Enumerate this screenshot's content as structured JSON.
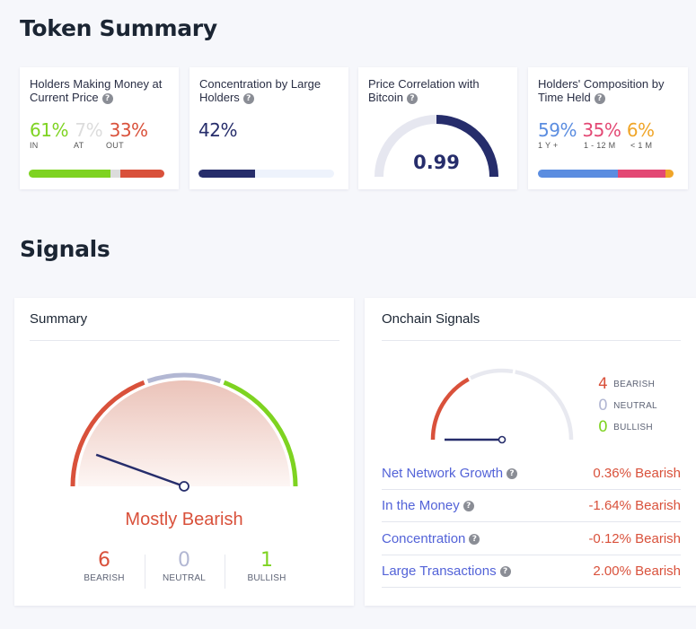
{
  "colors": {
    "green": "#7ed321",
    "red": "#d9513b",
    "grey_light": "#dcdcdc",
    "navy": "#262d6b",
    "neutral": "#b2b7d3",
    "blue": "#5b8de0",
    "pink": "#e34874",
    "orange": "#f0a528",
    "link": "#5363d8"
  },
  "token_summary": {
    "heading": "Token Summary",
    "cards": {
      "money": {
        "title": "Holders Making Money at Current Price",
        "help_icon": "?",
        "items": [
          {
            "value": "61%",
            "label": "IN",
            "fraction": 0.61
          },
          {
            "value": "7%",
            "label": "AT",
            "fraction": 0.07
          },
          {
            "value": "33%",
            "label": "OUT",
            "fraction": 0.33
          }
        ]
      },
      "concentration": {
        "title": "Concentration by Large Holders",
        "help_icon": "?",
        "value": "42%",
        "fraction": 0.42
      },
      "correlation": {
        "title": "Price Correlation with Bitcoin",
        "help_icon": "?",
        "value": "0.99",
        "numeric": 0.99,
        "range": [
          -1,
          1
        ]
      },
      "composition": {
        "title": "Holders' Composition by Time Held",
        "help_icon": "?",
        "items": [
          {
            "value": "59%",
            "label": "1 Y +",
            "fraction": 0.59
          },
          {
            "value": "35%",
            "label": "1 - 12 M",
            "fraction": 0.35
          },
          {
            "value": "6%",
            "label": "< 1 M",
            "fraction": 0.06
          }
        ]
      }
    }
  },
  "signals": {
    "heading": "Signals",
    "summary": {
      "title": "Summary",
      "verdict": "Mostly Bearish",
      "counts": [
        {
          "value": "6",
          "label": "BEARISH"
        },
        {
          "value": "0",
          "label": "NEUTRAL"
        },
        {
          "value": "1",
          "label": "BULLISH"
        }
      ],
      "needle_fraction": 0.11
    },
    "onchain": {
      "title": "Onchain Signals",
      "counts": [
        {
          "value": "4",
          "label": "BEARISH"
        },
        {
          "value": "0",
          "label": "NEUTRAL"
        },
        {
          "value": "0",
          "label": "BULLISH"
        }
      ],
      "needle_fraction": 0.0,
      "rows": [
        {
          "name": "Net Network Growth",
          "value": "0.36%",
          "verdict": "Bearish"
        },
        {
          "name": "In the Money",
          "value": "-1.64%",
          "verdict": "Bearish"
        },
        {
          "name": "Concentration",
          "value": "-0.12%",
          "verdict": "Bearish"
        },
        {
          "name": "Large Transactions",
          "value": "2.00%",
          "verdict": "Bearish"
        }
      ]
    }
  }
}
